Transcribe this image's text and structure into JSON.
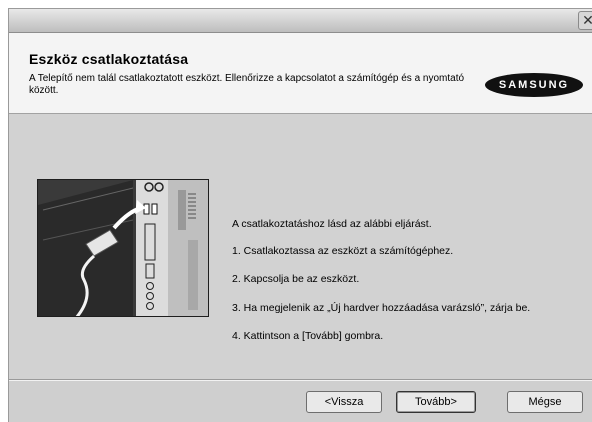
{
  "window": {
    "close_glyph": "✕"
  },
  "header": {
    "title": "Eszköz csatlakoztatása",
    "subtitle": "A Telepítő nem talál  csatlakoztatott eszközt. Ellenőrizze a kapcsolatot a számítógép és a nyomtató között.",
    "logo_text": "SAMSUNG"
  },
  "illustration": {
    "icon": "usb-connect-illustration"
  },
  "instructions": {
    "intro": "A csatlakoztatáshoz lásd az alábbi eljárást.",
    "steps": [
      "1. Csatlakoztassa az eszközt a számítógéphez.",
      "2. Kapcsolja be az eszközt.",
      "3. Ha megjelenik az „Új hardver hozzáadása varázsló”, zárja be.",
      "4. Kattintson a [Tovább] gombra."
    ]
  },
  "buttons": {
    "back": "<Vissza",
    "next": "Tovább>",
    "cancel": "Mégse"
  },
  "colors": {
    "dialog_bg": "#d2d2d2",
    "header_bg": "#f4f4f4",
    "logo_bg": "#111111"
  }
}
